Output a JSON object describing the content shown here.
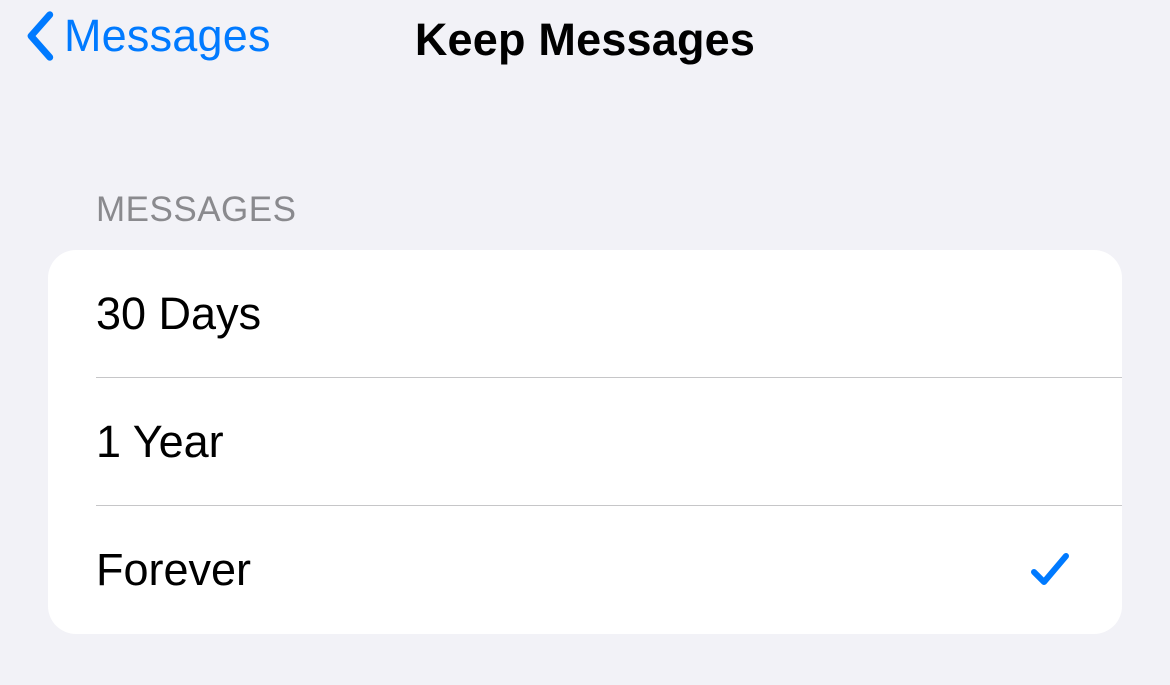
{
  "nav": {
    "back_label": "Messages",
    "title": "Keep Messages"
  },
  "section": {
    "header": "MESSAGES"
  },
  "options": [
    {
      "label": "30 Days",
      "selected": false
    },
    {
      "label": "1 Year",
      "selected": false
    },
    {
      "label": "Forever",
      "selected": true
    }
  ],
  "colors": {
    "accent": "#007aff",
    "background": "#f2f2f7",
    "row_background": "#ffffff",
    "section_header": "#8a8a8e",
    "separator": "#c6c6c8"
  }
}
